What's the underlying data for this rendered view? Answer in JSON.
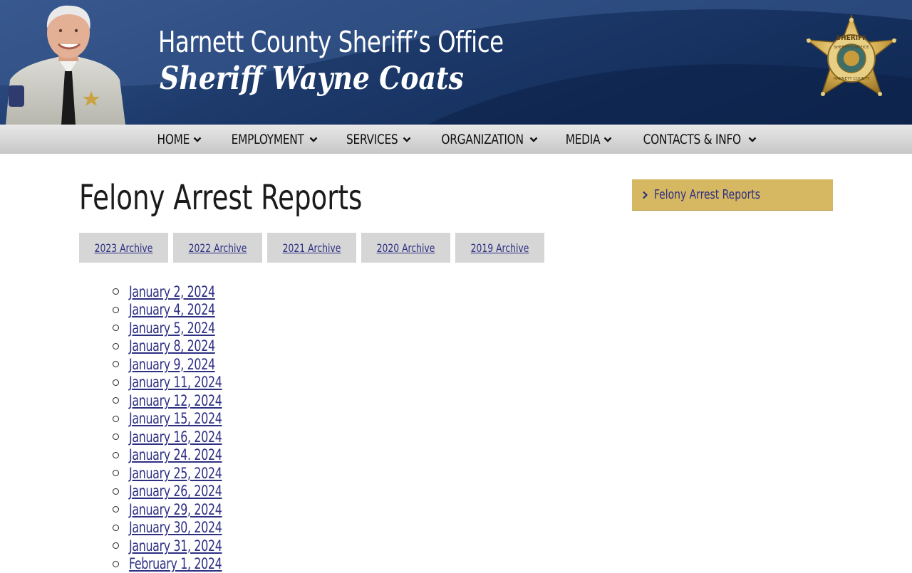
{
  "header": {
    "title": "Harnett County Sheriff’s Office",
    "subtitle": "Sheriff Wayne Coats",
    "badge_top_text": "SHERIFF",
    "badge_mid_text": "SHERIFF'S OFFICE",
    "badge_bottom_text": "HARNETT COUNTY"
  },
  "nav": {
    "items": [
      {
        "label": "HOME"
      },
      {
        "label": "EMPLOYMENT"
      },
      {
        "label": "SERVICES"
      },
      {
        "label": "ORGANIZATION"
      },
      {
        "label": "MEDIA"
      },
      {
        "label": "CONTACTS & INFO"
      }
    ]
  },
  "main": {
    "title": "Felony Arrest Reports",
    "archives": [
      {
        "label": "2023 Archive"
      },
      {
        "label": "2022 Archive"
      },
      {
        "label": "2021 Archive"
      },
      {
        "label": "2020 Archive"
      },
      {
        "label": "2019 Archive"
      }
    ],
    "reports": [
      "January 2, 2024",
      "January 4, 2024",
      "January 5, 2024",
      "January 8, 2024",
      "January 9, 2024",
      "January 11, 2024",
      "January 12, 2024",
      "January 15, 2024",
      "January 16, 2024",
      "January 24. 2024",
      "January 25, 2024",
      "January 26, 2024",
      "January 29, 2024",
      "January 30, 2024",
      "January 31, 2024",
      "February 1, 2024"
    ]
  },
  "sidebar": {
    "current_label": "Felony Arrest Reports"
  },
  "colors": {
    "header_dark": "#0f2752",
    "nav_gray": "#d3d3d3",
    "link": "#2d2f83",
    "sidebar_gold": "#d6b862",
    "archive_gray": "#d6d6d6"
  },
  "icons": {
    "nav_dropdown": "chevron-down-icon",
    "sidebar_arrow": "chevron-right-icon",
    "list_bullet": "circle-bullet-icon"
  }
}
